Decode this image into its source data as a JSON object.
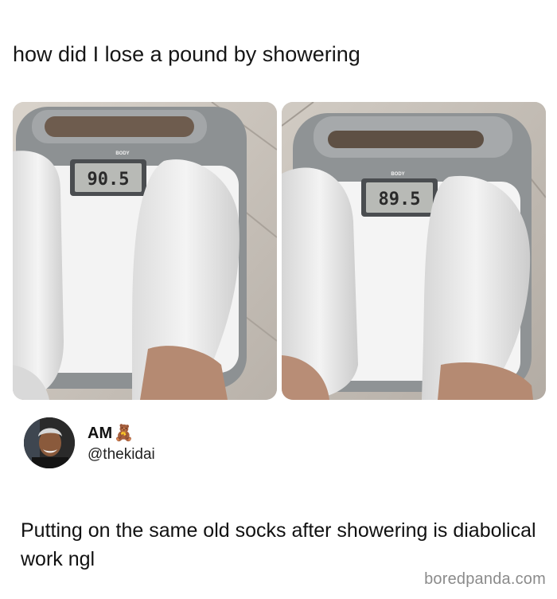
{
  "post": {
    "caption": "how did I lose a pound by showering"
  },
  "photos": {
    "left": {
      "reading": "90.5",
      "brand": "BODY"
    },
    "right": {
      "reading": "89.5",
      "brand": "BODY"
    }
  },
  "reply": {
    "display_name": "AM",
    "name_emoji": "🧸",
    "handle": "@thekidai",
    "text": "Putting on the same old socks after showering is diabolical work ngl"
  },
  "watermark": "boredpanda.com"
}
